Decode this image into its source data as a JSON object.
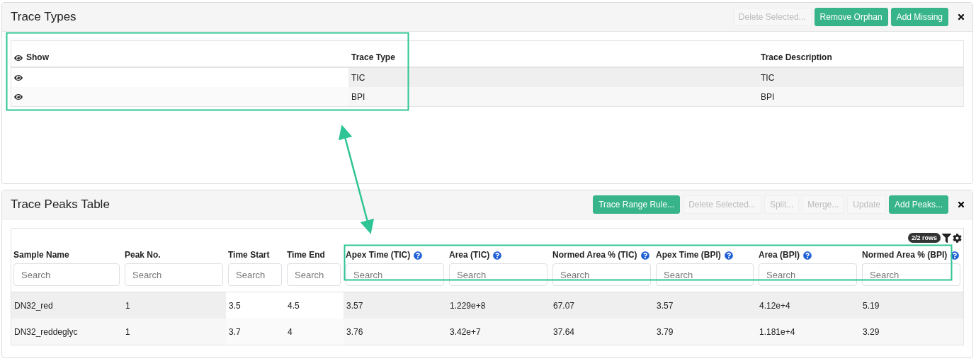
{
  "trace_types": {
    "title": "Trace Types",
    "buttons": [
      {
        "label": "Delete Selected...",
        "disabled": true
      },
      {
        "label": "Remove Orphan",
        "disabled": false
      },
      {
        "label": "Add Missing",
        "disabled": false
      }
    ],
    "columns": [
      {
        "label": "Show",
        "kind": "eye",
        "editable": true
      },
      {
        "label": "Trace Type",
        "kind": "text",
        "editable": false
      },
      {
        "label": "Trace Description",
        "kind": "text",
        "editable": false
      }
    ],
    "rows": [
      [
        "",
        "TIC",
        "TIC"
      ],
      [
        "",
        "BPI",
        "BPI"
      ]
    ]
  },
  "trace_peaks": {
    "title": "Trace Peaks Table",
    "buttons": [
      {
        "label": "Trace Range Rule...",
        "disabled": false
      },
      {
        "label": "Delete Selected...",
        "disabled": true
      },
      {
        "label": "Split...",
        "disabled": true
      },
      {
        "label": "Merge...",
        "disabled": true
      },
      {
        "label": "Update",
        "disabled": true
      },
      {
        "label": "Add Peaks...",
        "disabled": false
      }
    ],
    "row_count": "2/2 rows",
    "columns": [
      {
        "label": "Sample Name",
        "help": false,
        "editable": false,
        "placeholder": "Search"
      },
      {
        "label": "Peak No.",
        "help": false,
        "editable": false,
        "placeholder": "Search"
      },
      {
        "label": "Time Start",
        "help": false,
        "editable": true,
        "placeholder": "Search"
      },
      {
        "label": "Time End",
        "help": false,
        "editable": true,
        "placeholder": "Search"
      },
      {
        "label": "Apex Time (TIC)",
        "help": true,
        "editable": false,
        "placeholder": "Search"
      },
      {
        "label": "Area (TIC)",
        "help": true,
        "editable": false,
        "placeholder": "Search"
      },
      {
        "label": "Normed Area % (TIC)",
        "help": true,
        "editable": false,
        "placeholder": "Search"
      },
      {
        "label": "Apex Time (BPI)",
        "help": true,
        "editable": false,
        "placeholder": "Search"
      },
      {
        "label": "Area (BPI)",
        "help": true,
        "editable": false,
        "placeholder": "Search"
      },
      {
        "label": "Normed Area % (BPI)",
        "help": true,
        "editable": false,
        "placeholder": "Search"
      }
    ],
    "rows": [
      [
        "DN32_red",
        "1",
        "3.5",
        "4.5",
        "3.57",
        "1.229e+8",
        "67.07",
        "3.57",
        "4.12e+4",
        "5.19"
      ],
      [
        "DN32_reddeglyc",
        "1",
        "3.7",
        "4",
        "3.76",
        "3.42e+7",
        "37.64",
        "3.79",
        "1.181e+4",
        "3.29"
      ]
    ]
  }
}
